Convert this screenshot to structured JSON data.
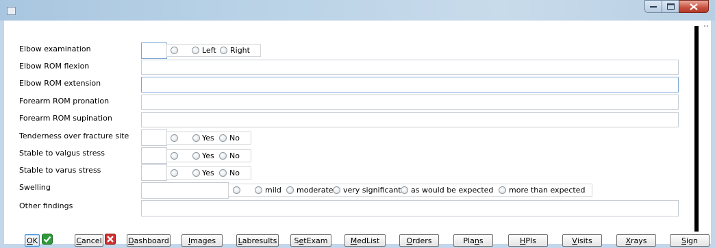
{
  "window": {
    "title": ""
  },
  "form": {
    "rows": [
      {
        "label": "Elbow examination"
      },
      {
        "label": "Elbow ROM flexion"
      },
      {
        "label": "Elbow ROM extension"
      },
      {
        "label": "Forearm ROM pronation"
      },
      {
        "label": "Forearm ROM supination"
      },
      {
        "label": "Tenderness over fracture site"
      },
      {
        "label": "Stable to valgus stress"
      },
      {
        "label": "Stable to varus stress"
      },
      {
        "label": "Swelling"
      },
      {
        "label": "Other findings"
      }
    ],
    "elbow_options": [
      "Left",
      "Right"
    ],
    "yesno_options": [
      "Yes",
      "No"
    ],
    "swelling_options": [
      "mild",
      "moderate",
      "very significant",
      "as would be expected",
      "more than expected"
    ]
  },
  "buttons": [
    {
      "label": "OK",
      "accel": "O"
    },
    {
      "label": "Cancel",
      "accel": "C"
    },
    {
      "label": "Dashboard",
      "accel": "D"
    },
    {
      "label": "Images",
      "accel": "I"
    },
    {
      "label": "Labresults",
      "accel": "L"
    },
    {
      "label": "SetExam",
      "accel": "e"
    },
    {
      "label": "MedList",
      "accel": "M"
    },
    {
      "label": "Orders",
      "accel": "O"
    },
    {
      "label": "Plans",
      "accel": "n"
    },
    {
      "label": "HPIs",
      "accel": "H"
    },
    {
      "label": "Visits",
      "accel": "V"
    },
    {
      "label": "Xrays",
      "accel": "X"
    },
    {
      "label": "Sign",
      "accel": "S"
    }
  ],
  "colors": {
    "titlebar": "#b9d2e6",
    "close_button": "#c8503e",
    "ok_icon": "#2f9a3a",
    "cancel_icon": "#d12f2f"
  }
}
